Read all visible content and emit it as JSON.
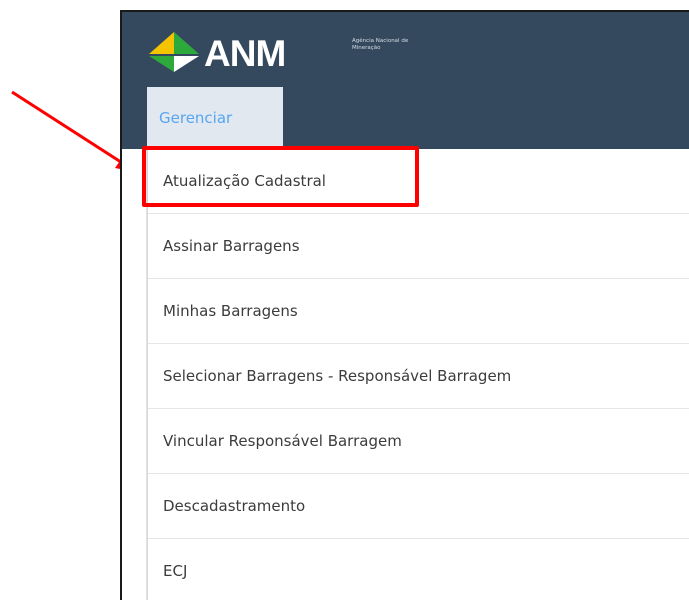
{
  "logo": {
    "text": "ANM",
    "subtitle": "Agência Nacional de Mineração"
  },
  "tab": {
    "label": "Gerenciar"
  },
  "menu": {
    "items": [
      {
        "label": "Atualização Cadastral"
      },
      {
        "label": "Assinar Barragens"
      },
      {
        "label": "Minhas Barragens"
      },
      {
        "label": "Selecionar Barragens - Responsável Barragem"
      },
      {
        "label": "Vincular Responsável Barragem"
      },
      {
        "label": "Descadastramento"
      },
      {
        "label": "ECJ"
      }
    ]
  },
  "colors": {
    "header_bg": "#34495e",
    "tab_bg": "#e1e8f0",
    "tab_text": "#58a6f0",
    "annotation": "#ff0000",
    "logo_green": "#2eaa3d",
    "logo_yellow": "#f5c400"
  },
  "icons": {
    "logo_mark": "diamond-logo-icon",
    "annotation": "red-arrow-annotation"
  }
}
